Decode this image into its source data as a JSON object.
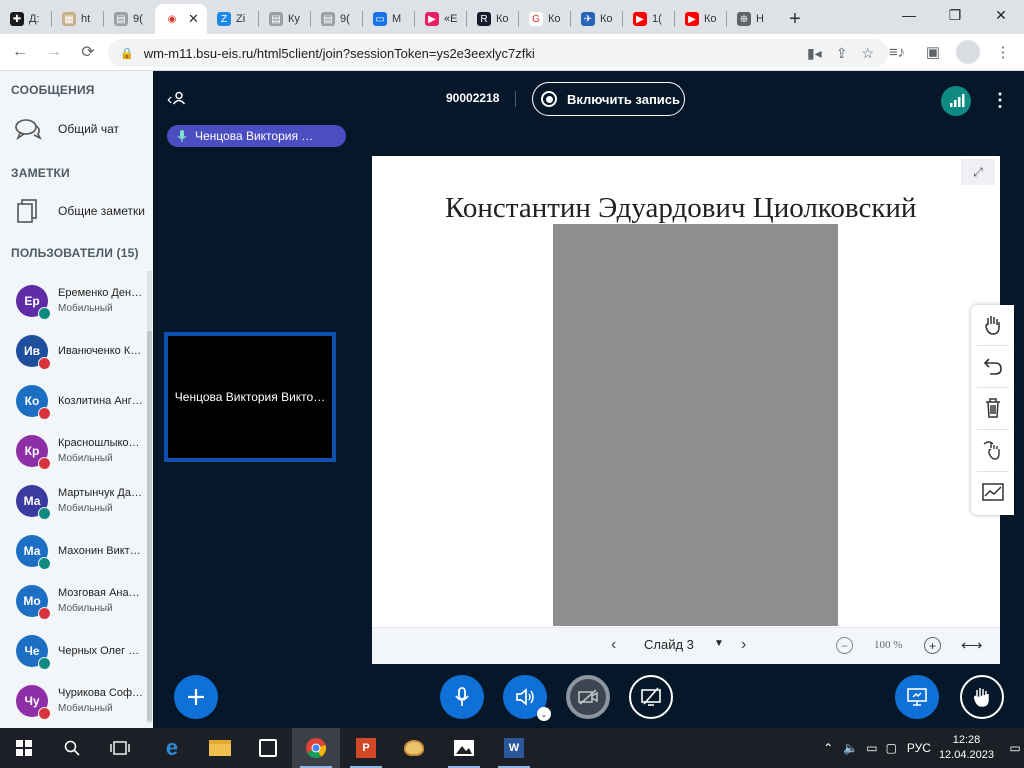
{
  "browser": {
    "tabs": [
      {
        "label": "Д:",
        "fav_color": "#1a1a1a",
        "glyph": "✚"
      },
      {
        "label": "ht",
        "fav_color": "#c9b28a",
        "glyph": "▦"
      },
      {
        "label": "9(",
        "fav_color": "#9aa0a6",
        "glyph": "▤"
      },
      {
        "label": "",
        "fav_color": "#ffffff",
        "glyph": "◉",
        "active": true
      },
      {
        "label": "Zi",
        "fav_color": "#1e88e5",
        "glyph": "Z"
      },
      {
        "label": "Ку",
        "fav_color": "#9aa0a6",
        "glyph": "▤"
      },
      {
        "label": "9(",
        "fav_color": "#9aa0a6",
        "glyph": "▤"
      },
      {
        "label": "М",
        "fav_color": "#1a73e8",
        "glyph": "▭"
      },
      {
        "label": "«E",
        "fav_color": "#e91e63",
        "glyph": "▶"
      },
      {
        "label": "Ко",
        "fav_color": "#1a1a2e",
        "glyph": "R"
      },
      {
        "label": "Ко",
        "fav_color": "#ffffff",
        "glyph": "G"
      },
      {
        "label": "Ко",
        "fav_color": "#2a64b8",
        "glyph": "✈"
      },
      {
        "label": "1(",
        "fav_color": "#ff0000",
        "glyph": "▶"
      },
      {
        "label": "Ко",
        "fav_color": "#ff0000",
        "glyph": "▶"
      },
      {
        "label": "Н",
        "fav_color": "#5f6368",
        "glyph": "⊕"
      }
    ],
    "new_tab": "+",
    "url": "wm-m11.bsu-eis.ru/html5client/join?sessionToken=ys2e3eexlyc7zfki"
  },
  "sidebar": {
    "messages_title": "СООБЩЕНИЯ",
    "public_chat": "Общий чат",
    "notes_title": "ЗАМЕТКИ",
    "shared_notes": "Общие заметки",
    "users_title": "ПОЛЬЗОВАТЕЛИ (15)",
    "users": [
      {
        "initials": "Ер",
        "name": "Еременко Ден…",
        "sub": "Мобильный",
        "color": "#5e2ca5",
        "status": "#0f8a83"
      },
      {
        "initials": "Ив",
        "name": "Иванюченко К…",
        "sub": "",
        "color": "#1d4f9c",
        "status": "#d9343b"
      },
      {
        "initials": "Ко",
        "name": "Козлитина Анг…",
        "sub": "",
        "color": "#1a6fc2",
        "status": "#d9343b"
      },
      {
        "initials": "Кр",
        "name": "Красношлыко…",
        "sub": "Мобильный",
        "color": "#8e2fa8",
        "status": "#d9343b"
      },
      {
        "initials": "Ма",
        "name": "Мартынчук Да…",
        "sub": "Мобильный",
        "color": "#3a3ba0",
        "status": "#0f8a83"
      },
      {
        "initials": "Ма",
        "name": "Махонин Викт…",
        "sub": "",
        "color": "#1d6fc4",
        "status": "#0f8a83"
      },
      {
        "initials": "Мо",
        "name": "Мозговая Ана…",
        "sub": "Мобильный",
        "color": "#1d6fc4",
        "status": "#d9343b"
      },
      {
        "initials": "Че",
        "name": "Черных Олег …",
        "sub": "",
        "color": "#1d6fc4",
        "status": "#0f8a83"
      },
      {
        "initials": "Чу",
        "name": "Чурикова Соф…",
        "sub": "Мобильный",
        "color": "#8e2fa8",
        "status": "#d9343b"
      }
    ]
  },
  "meeting": {
    "number": "90002218",
    "record_label": "Включить запись",
    "talking_user": "Ченцова Виктория …",
    "webcam_name": "Ченцова Виктория Викто…"
  },
  "slide": {
    "title": "Константин Эдуардович Циолковский",
    "label": "Слайд 3",
    "zoom": "100 %"
  },
  "taskbar": {
    "lang": "РУС",
    "time": "12:28",
    "date": "12.04.2023"
  },
  "colors": {
    "accent": "#0f70d7",
    "dark_bg": "#06172a",
    "talking_badge": "#4a4ec2",
    "webcam_border": "#0f4fb0"
  }
}
